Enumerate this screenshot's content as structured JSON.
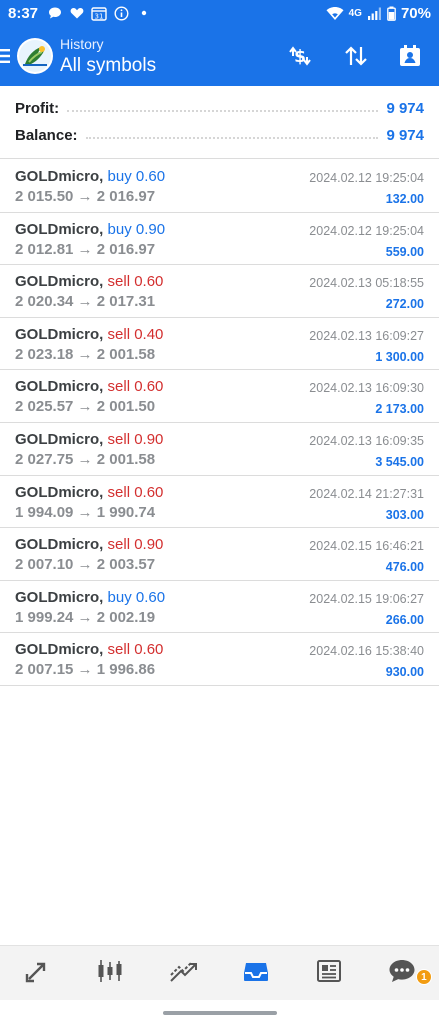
{
  "status_bar": {
    "time": "8:37",
    "network": "4G",
    "battery": "70%",
    "calendar_day": "31",
    "icons": [
      "chat-bubble-icon",
      "heart-icon",
      "calendar-icon",
      "info-icon",
      "dot-icon",
      "wifi-icon",
      "signal-icon",
      "battery-icon"
    ]
  },
  "app_bar": {
    "subtitle": "History",
    "title": "All symbols",
    "actions": [
      "currency-exchange-icon",
      "sort-arrows-icon",
      "report-icon"
    ]
  },
  "summary": {
    "profit_label": "Profit:",
    "profit_value": "9 974",
    "balance_label": "Balance:",
    "balance_value": "9 974"
  },
  "deals": [
    {
      "symbol": "GOLDmicro,",
      "side": "buy 0.60",
      "type": "buy",
      "prices": "2 015.50 → 2 016.97",
      "time": "2024.02.12 19:25:04",
      "profit": "132.00"
    },
    {
      "symbol": "GOLDmicro,",
      "side": "buy 0.90",
      "type": "buy",
      "prices": "2 012.81 → 2 016.97",
      "time": "2024.02.12 19:25:04",
      "profit": "559.00"
    },
    {
      "symbol": "GOLDmicro,",
      "side": "sell 0.60",
      "type": "sell",
      "prices": "2 020.34 → 2 017.31",
      "time": "2024.02.13 05:18:55",
      "profit": "272.00"
    },
    {
      "symbol": "GOLDmicro,",
      "side": "sell 0.40",
      "type": "sell",
      "prices": "2 023.18 → 2 001.58",
      "time": "2024.02.13 16:09:27",
      "profit": "1 300.00"
    },
    {
      "symbol": "GOLDmicro,",
      "side": "sell 0.60",
      "type": "sell",
      "prices": "2 025.57 → 2 001.50",
      "time": "2024.02.13 16:09:30",
      "profit": "2 173.00"
    },
    {
      "symbol": "GOLDmicro,",
      "side": "sell 0.90",
      "type": "sell",
      "prices": "2 027.75 → 2 001.58",
      "time": "2024.02.13 16:09:35",
      "profit": "3 545.00"
    },
    {
      "symbol": "GOLDmicro,",
      "side": "sell 0.60",
      "type": "sell",
      "prices": "1 994.09 → 1 990.74",
      "time": "2024.02.14 21:27:31",
      "profit": "303.00"
    },
    {
      "symbol": "GOLDmicro,",
      "side": "sell 0.90",
      "type": "sell",
      "prices": "2 007.10 → 2 003.57",
      "time": "2024.02.15 16:46:21",
      "profit": "476.00"
    },
    {
      "symbol": "GOLDmicro,",
      "side": "buy 0.60",
      "type": "buy",
      "prices": "1 999.24 → 2 002.19",
      "time": "2024.02.15 19:06:27",
      "profit": "266.00"
    },
    {
      "symbol": "GOLDmicro,",
      "side": "sell 0.60",
      "type": "sell",
      "prices": "2 007.15 → 1 996.86",
      "time": "2024.02.16 15:38:40",
      "profit": "930.00"
    }
  ],
  "bottom_nav": {
    "items": [
      {
        "name": "quotes-nav",
        "icon": "arrows-diagonal-icon",
        "active": false
      },
      {
        "name": "chart-nav",
        "icon": "candlestick-icon",
        "active": false
      },
      {
        "name": "trade-nav",
        "icon": "trend-lines-icon",
        "active": false
      },
      {
        "name": "history-nav",
        "icon": "inbox-icon",
        "active": true
      },
      {
        "name": "news-nav",
        "icon": "newspaper-icon",
        "active": false
      },
      {
        "name": "messages-nav",
        "icon": "chat-icon",
        "active": false
      }
    ],
    "messages_badge": "1"
  },
  "colors": {
    "accent": "#1a73e8",
    "sell": "#d32f2f",
    "muted": "#8a8d91",
    "badge": "#f29c11"
  }
}
